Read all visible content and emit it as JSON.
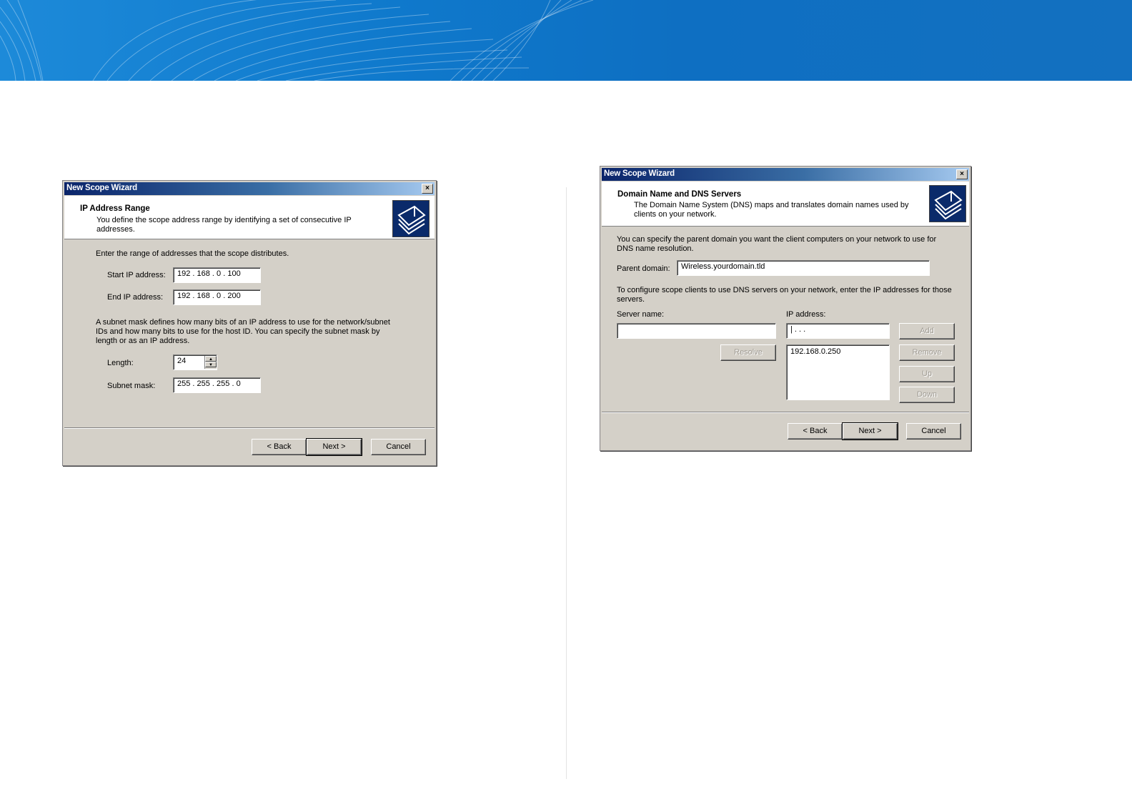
{
  "colors": {
    "banner": "#0e6fc2",
    "titlebar": "#0a246a",
    "dialog_face": "#d4d0c8"
  },
  "dialog1": {
    "title": "New Scope Wizard",
    "close": "×",
    "header_title": "IP Address Range",
    "header_desc": "You define the scope address range by identifying a set of consecutive IP addresses.",
    "icon": "scope-wizard-icon",
    "intro": "Enter the range of addresses that the scope distributes.",
    "start_label": "Start IP address:",
    "start_value": "192 . 168 .   0   . 100",
    "end_label": "End IP address:",
    "end_value": "192 . 168 .   0   . 200",
    "subnet_text": "A subnet mask defines how many bits of an IP address to use for the network/subnet IDs and how many bits to use for the host ID. You can specify the subnet mask by length or as an IP address.",
    "length_label": "Length:",
    "length_value": "24",
    "mask_label": "Subnet mask:",
    "mask_value": "255 . 255 . 255 .   0",
    "back": "< Back",
    "next": "Next >",
    "cancel": "Cancel"
  },
  "dialog2": {
    "title": "New Scope Wizard",
    "close": "×",
    "header_title": "Domain Name and DNS Servers",
    "header_desc": "The Domain Name System (DNS) maps and translates domain names used by clients on your network.",
    "icon": "scope-wizard-icon",
    "intro": "You can specify the parent domain you want the client computers on your network to use for DNS name resolution.",
    "parent_label": "Parent domain:",
    "parent_value": "Wireless.yourdomain.tld",
    "config_text": "To configure scope clients to use DNS servers on your network, enter the IP addresses for those servers.",
    "server_label": "Server name:",
    "server_value": "",
    "ip_label": "IP address:",
    "ip_value": "|    .        .        .",
    "resolve": "Resolve",
    "add": "Add",
    "remove": "Remove",
    "up": "Up",
    "down": "Down",
    "list": [
      "192.168.0.250"
    ],
    "back": "< Back",
    "next": "Next >",
    "cancel": "Cancel"
  }
}
